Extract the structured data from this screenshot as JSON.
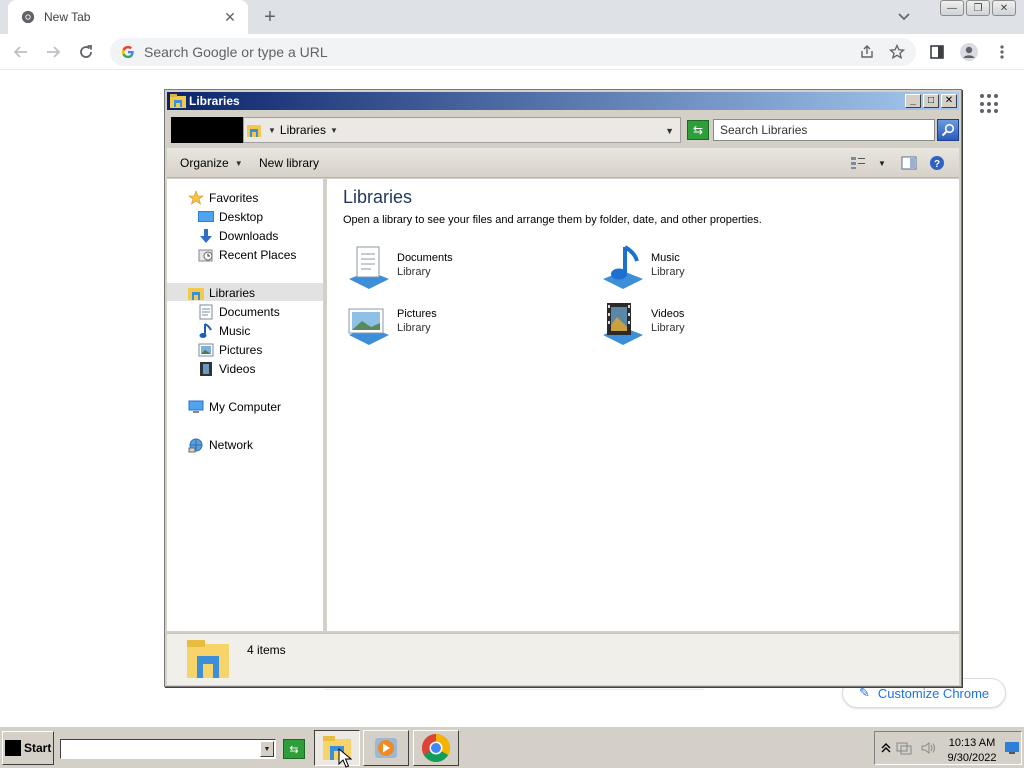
{
  "browser": {
    "tab_title": "New Tab",
    "omnibox_placeholder": "Search Google or type a URL",
    "customize_label": "Customize Chrome"
  },
  "explorer": {
    "window_title": "Libraries",
    "breadcrumb": "Libraries",
    "search_placeholder": "Search Libraries",
    "organize_label": "Organize",
    "new_library_label": "New library",
    "content_title": "Libraries",
    "content_subtitle": "Open a library to see your files and arrange them by folder, date, and other properties.",
    "nav": {
      "favorites": "Favorites",
      "desktop": "Desktop",
      "downloads": "Downloads",
      "recent": "Recent Places",
      "libraries": "Libraries",
      "documents": "Documents",
      "music": "Music",
      "pictures": "Pictures",
      "videos": "Videos",
      "computer": "My Computer",
      "network": "Network"
    },
    "libraries": [
      {
        "name": "Documents",
        "type": "Library",
        "icon": "documents-library-icon"
      },
      {
        "name": "Music",
        "type": "Library",
        "icon": "music-library-icon"
      },
      {
        "name": "Pictures",
        "type": "Library",
        "icon": "pictures-library-icon"
      },
      {
        "name": "Videos",
        "type": "Library",
        "icon": "videos-library-icon"
      }
    ],
    "status": "4 items"
  },
  "taskbar": {
    "start_label": "Start",
    "time": "10:13 AM",
    "date": "9/30/2022"
  },
  "colors": {
    "title_gradient_start": "#0a246a",
    "title_gradient_end": "#a6caf0",
    "chrome_blue": "#1a73e8",
    "classic_gray": "#d4d0c8"
  }
}
